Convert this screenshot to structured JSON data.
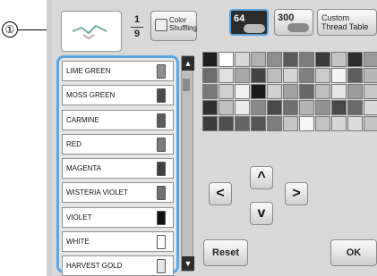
{
  "callout": {
    "number": "①"
  },
  "header": {
    "counter_current": "1",
    "counter_total": "9",
    "color_shuffling_label": "Color Shuffling"
  },
  "thread_list": {
    "items": [
      {
        "label": "LIME GREEN",
        "color": "#8e8e8e"
      },
      {
        "label": "MOSS GREEN",
        "color": "#4a4a4a"
      },
      {
        "label": "CARMINE",
        "color": "#5e5e5e"
      },
      {
        "label": "RED",
        "color": "#7a7a7a"
      },
      {
        "label": "MAGENTA",
        "color": "#3e3e3e"
      },
      {
        "label": "WISTERIA VIOLET",
        "color": "#707070"
      },
      {
        "label": "VIOLET",
        "color": "#111111"
      },
      {
        "label": "WHITE",
        "color": "#ffffff"
      },
      {
        "label": "HARVEST GOLD",
        "color": "#e8e8e8"
      }
    ]
  },
  "scroll": {
    "up_icon": "▲",
    "down_icon": "▼"
  },
  "palette_tabs": {
    "tab_64": "64",
    "tab_300": "300",
    "custom": "Custom Thread Table"
  },
  "palette": {
    "colors": [
      "#1f1f1f",
      "#ffffff",
      "#d8d8d8",
      "#b0b0b0",
      "#8e8e8e",
      "#5a5a5a",
      "#7c7c7c",
      "#3a3a3a",
      "#c4c4c4",
      "#2c2c2c",
      "#9a9a9a",
      "#6c6c6c",
      "#e0e0e0",
      "#a8a8a8",
      "#444444",
      "#bcbcbc",
      "#d4d4d4",
      "#808080",
      "#cccccc",
      "#f4f4f4",
      "#5e5e5e",
      "#b8b8b8",
      "#7a7a7a",
      "#cfcfcf",
      "#f0f0f0",
      "#1a1a1a",
      "#d0d0d0",
      "#a2a2a2",
      "#686868",
      "#bdbdbd",
      "#e6e6e6",
      "#9c9c9c",
      "#c8c8c8",
      "#303030",
      "#c0c0c0",
      "#eaeaea",
      "#8a8a8a",
      "#4a4a4a",
      "#707070",
      "#b4b4b4",
      "#929292",
      "#484848",
      "#6a6a6a",
      "#dadada",
      "#3c3c3c",
      "#505050",
      "#646464",
      "#565656",
      "#7e7e7e",
      "#c6c6c6",
      "#f6f6f6",
      "#c2c2c2",
      "#d6d6d6",
      "#dcdcdc",
      "#c2c2c2"
    ]
  },
  "arrows": {
    "up": "^",
    "down": "v",
    "left": "<",
    "right": ">"
  },
  "footer": {
    "reset": "Reset",
    "ok": "OK"
  }
}
